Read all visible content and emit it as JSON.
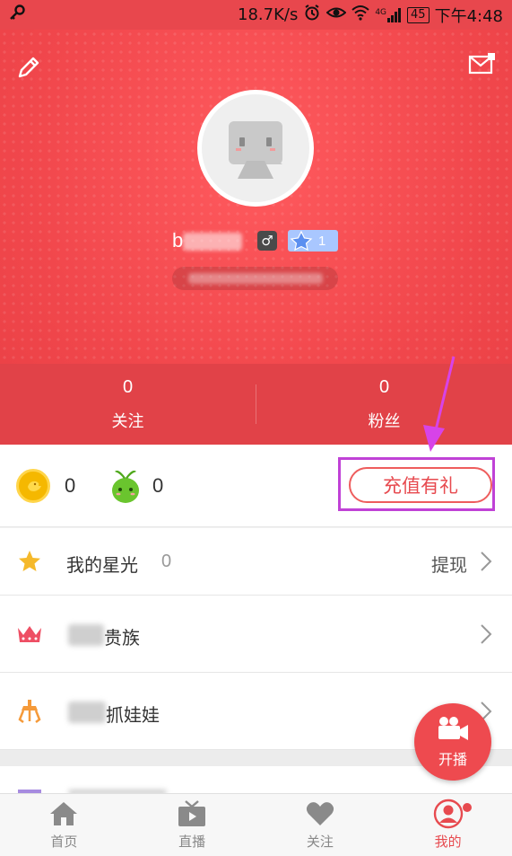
{
  "status_bar": {
    "net_speed": "18.7K/s",
    "signal_label": "4G",
    "battery": "45",
    "time": "下午4:48"
  },
  "header": {
    "edit_icon": "pencil-icon",
    "mail_icon": "mail-icon",
    "username_visible": "b",
    "gender_symbol": "♂",
    "level": "1"
  },
  "stats": {
    "following_count": "0",
    "following_label": "关注",
    "fans_count": "0",
    "fans_label": "粉丝"
  },
  "wallet": {
    "coins": "0",
    "beans": "0",
    "recharge_label": "充值有礼"
  },
  "list": {
    "star_light_label": "我的星光",
    "star_light_count": "0",
    "withdraw_label": "提现",
    "nobility_label": "贵族",
    "claw_label": "抓娃娃"
  },
  "fab": {
    "label": "开播"
  },
  "nav": {
    "items": [
      {
        "label": "首页",
        "icon": "home-icon"
      },
      {
        "label": "直播",
        "icon": "tv-icon"
      },
      {
        "label": "关注",
        "icon": "heart-icon"
      },
      {
        "label": "我的",
        "icon": "profile-icon"
      }
    ]
  },
  "colors": {
    "brand_red": "#ee4a4f",
    "highlight_purple": "#c042d6"
  }
}
